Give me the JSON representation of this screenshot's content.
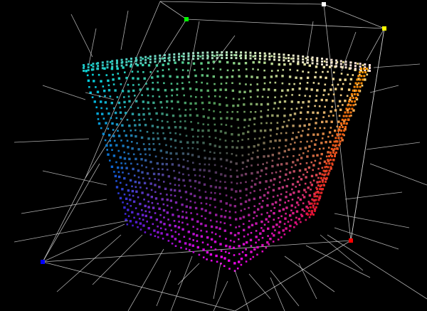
{
  "scene": {
    "background": "#000000",
    "frame_color": "#d8d8d8",
    "corner_markers": [
      {
        "name": "white-corner-marker",
        "color": "#ffffff"
      },
      {
        "name": "yellow-corner-marker",
        "color": "#ffff00"
      },
      {
        "name": "green-corner-marker",
        "color": "#00ff00"
      },
      {
        "name": "blue-corner-marker",
        "color": "#0000ff"
      },
      {
        "name": "red-corner-marker",
        "color": "#ff0000"
      }
    ],
    "solid_faces": {
      "front": [
        "#00e0e0",
        "#ff00ff",
        "#ff9900"
      ],
      "top": [
        "#20c0c0",
        "#e0f0c0",
        "#ffe0e0"
      ]
    }
  }
}
